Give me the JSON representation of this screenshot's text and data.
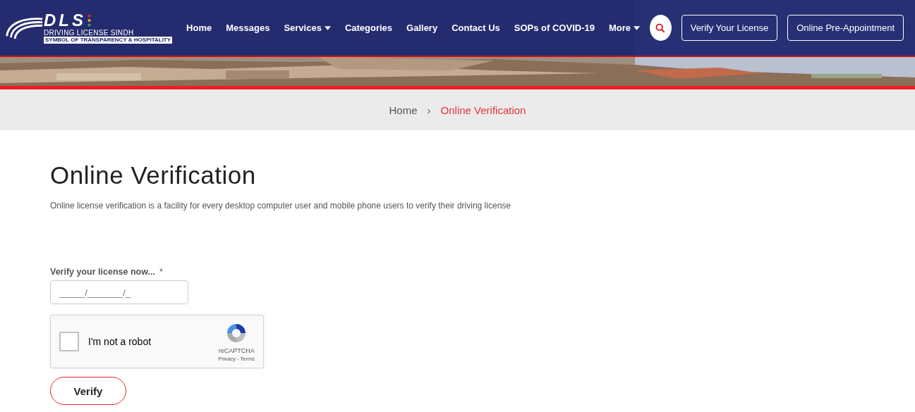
{
  "logo": {
    "mark": "DLS",
    "name": "DRIVING LICENSE SINDH",
    "tagline": "SYMBOL OF TRANSPARENCY & HOSPITALITY"
  },
  "nav": [
    {
      "label": "Home",
      "kind": "link"
    },
    {
      "label": "Messages",
      "kind": "link"
    },
    {
      "label": "Services",
      "kind": "dropdown"
    },
    {
      "label": "Categories",
      "kind": "link"
    },
    {
      "label": "Gallery",
      "kind": "link"
    },
    {
      "label": "Contact Us",
      "kind": "link"
    },
    {
      "label": "SOPs of COVID-19",
      "kind": "link"
    },
    {
      "label": "More",
      "kind": "dropdown"
    }
  ],
  "header_buttons": [
    "Verify Your License",
    "Online Pre-Appointment"
  ],
  "breadcrumb": [
    {
      "label": "Home",
      "selected": false
    },
    {
      "label": "Online Verification",
      "selected": true
    }
  ],
  "breadcrumb_separator": "›",
  "page": {
    "title": "Online Verification",
    "description": "Online license verification is a facility for every desktop computer user and mobile phone users to verify their driving license"
  },
  "form": {
    "label": "Verify your license now...",
    "required_mark": "*",
    "placeholder": "_____/_______/_"
  },
  "captcha": {
    "label": "I'm not a robot",
    "checked": false,
    "brand": "reCAPTCHA",
    "links": "Privacy - Terms"
  },
  "submit": "Verify"
}
